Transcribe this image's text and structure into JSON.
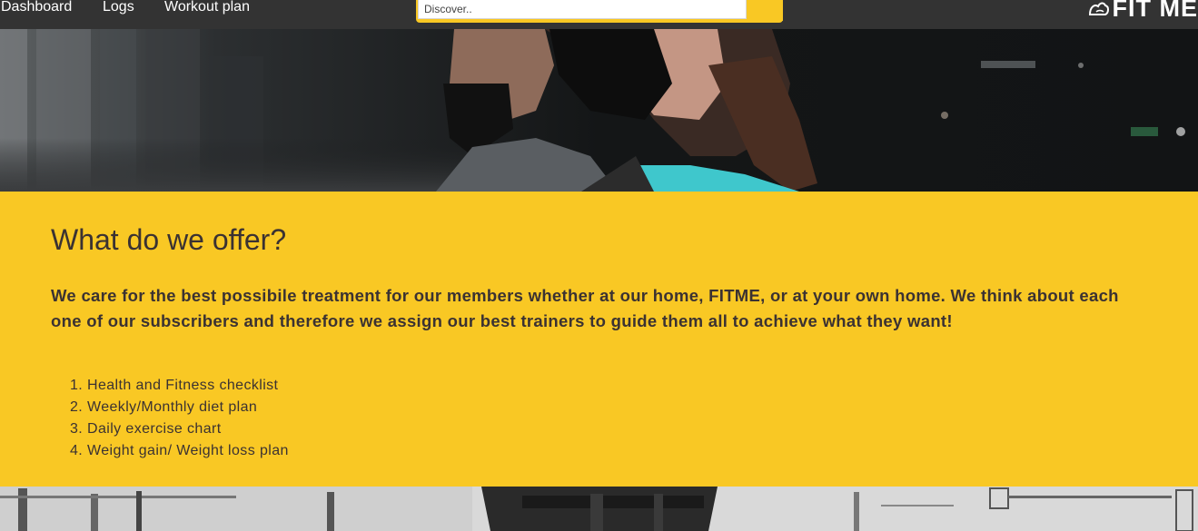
{
  "nav": {
    "links": [
      "Dashboard",
      "Logs",
      "Workout plan"
    ]
  },
  "search": {
    "placeholder": "Discover.."
  },
  "brand": {
    "name": "FIT ME"
  },
  "offer": {
    "title": "What do we offer?",
    "description": "We care for the best possibile treatment for our members whether at our home, FITME, or at your own home. We think about each one of our subscribers and therefore we assign our best trainers to guide them all to achieve what they want!",
    "items": [
      "Health and Fitness checklist",
      "Weekly/Monthly diet plan",
      "Daily exercise chart",
      "Weight gain/ Weight loss plan"
    ]
  },
  "colors": {
    "accent": "#f9c824",
    "navbar": "#333333",
    "text": "#3b3232"
  }
}
